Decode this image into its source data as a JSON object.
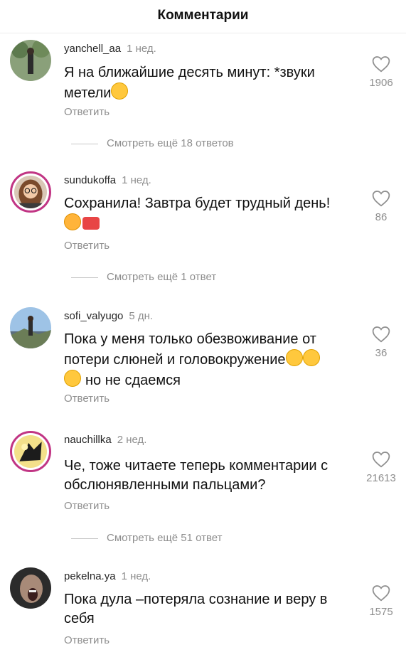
{
  "header": {
    "title": "Комментарии"
  },
  "comments": [
    {
      "username": "yanchell_aa",
      "time": "1 нед.",
      "text": "Я на ближайшие десять минут: *звуки метели",
      "emoji": [
        "tears-of-joy"
      ],
      "likes": "1906",
      "reply_label": "Ответить",
      "more_replies": "Смотреть ещё 18 ответов"
    },
    {
      "username": "sundukoffa",
      "time": "1 нед.",
      "text": "Сохранила! Завтра будет трудный день!",
      "emoji": [
        "hugging-face",
        "megaphone"
      ],
      "likes": "86",
      "reply_label": "Ответить",
      "more_replies": "Смотреть ещё 1 ответ"
    },
    {
      "username": "sofi_valyugo",
      "time": "5 дн.",
      "text_line1": "Пока у меня только обезвоживание от потери слюней и головокружение",
      "text_line2": "но не сдаемся",
      "emoji": [
        "tears-of-joy",
        "tears-of-joy",
        "tears-of-joy"
      ],
      "likes": "36",
      "reply_label": "Ответить"
    },
    {
      "username": "nauchillka",
      "time": "2 нед.",
      "text": "Че, тоже читаете теперь комментарии с обслюнявленными пальцами?",
      "likes": "21613",
      "reply_label": "Ответить",
      "more_replies": "Смотреть ещё 51 ответ"
    },
    {
      "username": "pekelna.ya",
      "time": "1 нед.",
      "text": "Пока дула –потеряла сознание и веру в себя",
      "likes": "1575",
      "reply_label": "Ответить"
    }
  ],
  "colors": {
    "story_ring": "#c13584",
    "muted": "#8e8e8e",
    "emoji_yellow": "#ffc83d"
  }
}
